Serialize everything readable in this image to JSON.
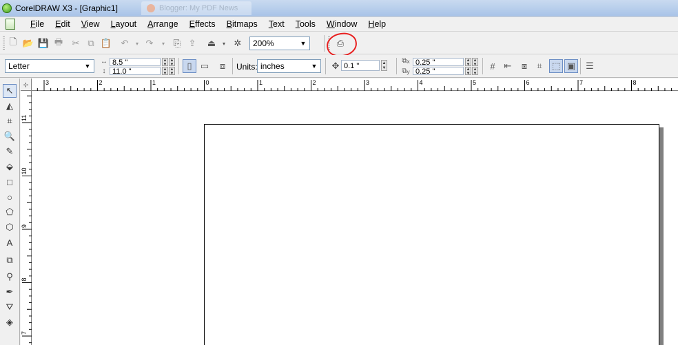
{
  "window": {
    "title": "CorelDRAW X3 - [Graphic1]",
    "background_tab": "Blogger: My PDF News"
  },
  "menu": [
    "File",
    "Edit",
    "View",
    "Layout",
    "Arrange",
    "Effects",
    "Bitmaps",
    "Text",
    "Tools",
    "Window",
    "Help"
  ],
  "standard_toolbar": {
    "zoom_value": "200%"
  },
  "property_bar": {
    "paper_type": "Letter",
    "page_width": "8.5 \"",
    "page_height": "11.0 \"",
    "units_label": "Units:",
    "units_value": "inches",
    "nudge_value": "0.1 \"",
    "duplicate_x": "0.25 \"",
    "duplicate_y": "0.25 \"",
    "dup_x_label": "x",
    "dup_y_label": "y"
  },
  "ruler": {
    "corner": "⊹",
    "horizontal_ticks": [
      "3",
      "2",
      "1",
      "0",
      "1",
      "2",
      "3",
      "4",
      "5",
      "6",
      "7",
      "8"
    ],
    "vertical_ticks": [
      "11",
      "10",
      "9",
      "8",
      "7"
    ]
  },
  "colors": {
    "highlight": "#e82020",
    "page_shadow": "#808080"
  }
}
